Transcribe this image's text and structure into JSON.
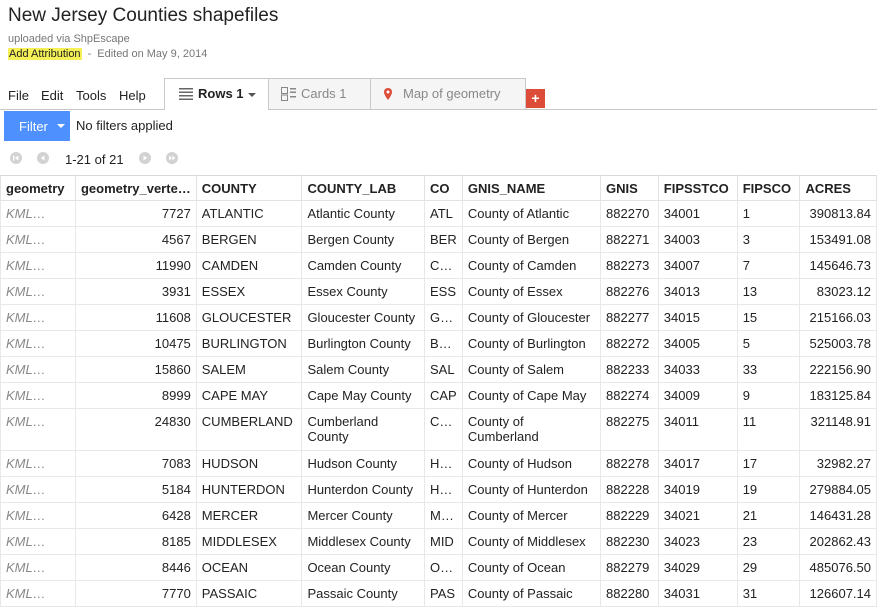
{
  "title": "New Jersey Counties shapefiles",
  "subtitle": "uploaded via ShpEscape",
  "attribution": {
    "label": "Add Attribution",
    "separator": "-",
    "edited": "Edited on May 9, 2014"
  },
  "menu": [
    "File",
    "Edit",
    "Tools",
    "Help"
  ],
  "tabs": [
    {
      "label": "Rows 1",
      "icon": "rows-icon",
      "active": true
    },
    {
      "label": "Cards 1",
      "icon": "cards-icon",
      "active": false
    },
    {
      "label": "Map of geometry",
      "icon": "map-pin-icon",
      "active": false
    }
  ],
  "add_tab_label": "+",
  "filter": {
    "button": "Filter",
    "status": "No filters applied"
  },
  "pager": {
    "text": "1-21 of 21"
  },
  "columns": [
    "geometry",
    "geometry_verte…",
    "COUNTY",
    "COUNTY_LAB",
    "CO",
    "GNIS_NAME",
    "GNIS",
    "FIPSSTCO",
    "FIPSCO",
    "ACRES"
  ],
  "rows": [
    [
      "KML…",
      "7727",
      "ATLANTIC",
      "Atlantic County",
      "ATL",
      "County of Atlantic",
      "882270",
      "34001",
      "1",
      "390813.84"
    ],
    [
      "KML…",
      "4567",
      "BERGEN",
      "Bergen County",
      "BER",
      "County of Bergen",
      "882271",
      "34003",
      "3",
      "153491.08"
    ],
    [
      "KML…",
      "11990",
      "CAMDEN",
      "Camden County",
      "C…",
      "County of Camden",
      "882273",
      "34007",
      "7",
      "145646.73"
    ],
    [
      "KML…",
      "3931",
      "ESSEX",
      "Essex County",
      "ESS",
      "County of Essex",
      "882276",
      "34013",
      "13",
      "83023.12"
    ],
    [
      "KML…",
      "11608",
      "GLOUCESTER",
      "Gloucester County",
      "G…",
      "County of Gloucester",
      "882277",
      "34015",
      "15",
      "215166.03"
    ],
    [
      "KML…",
      "10475",
      "BURLINGTON",
      "Burlington County",
      "B…",
      "County of Burlington",
      "882272",
      "34005",
      "5",
      "525003.78"
    ],
    [
      "KML…",
      "15860",
      "SALEM",
      "Salem County",
      "SAL",
      "County of Salem",
      "882233",
      "34033",
      "33",
      "222156.90"
    ],
    [
      "KML…",
      "8999",
      "CAPE MAY",
      "Cape May County",
      "CAP",
      "County of Cape May",
      "882274",
      "34009",
      "9",
      "183125.84"
    ],
    [
      "KML…",
      "24830",
      "CUMBERLAND",
      "Cumberland County",
      "C…",
      "County of Cumberland",
      "882275",
      "34011",
      "11",
      "321148.91"
    ],
    [
      "KML…",
      "7083",
      "HUDSON",
      "Hudson County",
      "H…",
      "County of Hudson",
      "882278",
      "34017",
      "17",
      "32982.27"
    ],
    [
      "KML…",
      "5184",
      "HUNTERDON",
      "Hunterdon County",
      "H…",
      "County of Hunterdon",
      "882228",
      "34019",
      "19",
      "279884.05"
    ],
    [
      "KML…",
      "6428",
      "MERCER",
      "Mercer County",
      "M…",
      "County of Mercer",
      "882229",
      "34021",
      "21",
      "146431.28"
    ],
    [
      "KML…",
      "8185",
      "MIDDLESEX",
      "Middlesex County",
      "MID",
      "County of Middlesex",
      "882230",
      "34023",
      "23",
      "202862.43"
    ],
    [
      "KML…",
      "8446",
      "OCEAN",
      "Ocean County",
      "O…",
      "County of Ocean",
      "882279",
      "34029",
      "29",
      "485076.50"
    ],
    [
      "KML…",
      "7770",
      "PASSAIC",
      "Passaic County",
      "PAS",
      "County of Passaic",
      "882280",
      "34031",
      "31",
      "126607.14"
    ]
  ]
}
